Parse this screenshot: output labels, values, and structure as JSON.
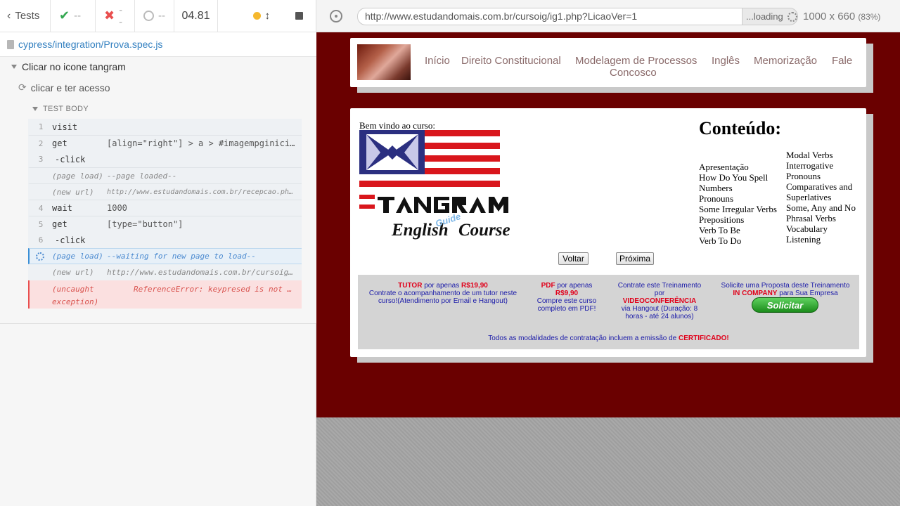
{
  "reporter": {
    "back_label": "Tests",
    "passed": "--",
    "failed": "--",
    "pending": "--",
    "duration": "04.81",
    "spec_path": "cypress/integration/Prova.spec.js",
    "suite_title": "Clicar no icone tangram",
    "test_title": "clicar e ter acesso",
    "body_label": "TEST BODY",
    "commands": [
      {
        "num": "1",
        "name": "visit",
        "msg": ""
      },
      {
        "num": "2",
        "name": "get",
        "msg": "[align=\"right\"] > a > #imagempginicial2"
      },
      {
        "num": "3",
        "name": "-click",
        "msg": ""
      },
      {
        "num": "",
        "name": "(page load)",
        "msg": "--page loaded--"
      },
      {
        "num": "",
        "name": "(new url)",
        "msg": "http://www.estudandomais.com.br/recepcao.php?Di…"
      },
      {
        "num": "4",
        "name": "wait",
        "msg": "1000"
      },
      {
        "num": "5",
        "name": "get",
        "msg": "[type=\"button\"]"
      },
      {
        "num": "6",
        "name": "-click",
        "msg": ""
      },
      {
        "num": "",
        "name": "(page load)",
        "msg": "--waiting for new page to load--"
      },
      {
        "num": "",
        "name": "(new url)",
        "msg": "http://www.estudandomais.com.br/cursoig/…"
      },
      {
        "num": "",
        "name": "(uncaught exception)",
        "msg": "ReferenceError: keypresed is not d…"
      }
    ]
  },
  "browser": {
    "url": "http://www.estudandomais.com.br/cursoig/ig1.php?LicaoVer=1",
    "loading_label": "...loading",
    "viewport": "1000 x 660",
    "scale": "(83%)"
  },
  "site": {
    "menu": [
      "Início",
      "Direito Constitucional",
      "Modelagem de Processos",
      "Inglês",
      "Memorização",
      "Fale",
      "Concosco"
    ],
    "welcome": "Bem vindo ao curso:",
    "logo_text": {
      "tangram": "TANGRAM",
      "english": "English",
      "course": "Course",
      "guide": "Guide"
    },
    "content_title": "Conteúdo:",
    "lessons_col1": [
      "Apresentação",
      "How Do You Spell",
      "Numbers",
      "Pronouns",
      "Some Irregular Verbs",
      "Prepositions",
      "Verb To Be",
      "Verb To Do"
    ],
    "lessons_col2": [
      "Modal Verbs",
      "Interrogative",
      "Pronouns",
      "Comparatives and",
      "Superlatives",
      "Some, Any and No",
      "Phrasal Verbs",
      "Vocabulary",
      "Listening"
    ],
    "btn_back": "Voltar",
    "btn_next": "Próxima",
    "promo": {
      "tutor_red": "TUTOR",
      "tutor_rest": "por apenas",
      "tutor_price": "R$19,90",
      "tutor_desc": "Contrate o acompanhamento de um tutor neste curso!(Atendimento por Email e Hangout)",
      "pdf_red": "PDF",
      "pdf_rest": "por apenas",
      "pdf_price": "R$9,90",
      "pdf_desc": "Compre este curso completo em PDF!",
      "video_pre": "Contrate este Treinamento por",
      "video_red": "VIDEOCONFERÊNCIA",
      "video_desc": "via Hangout (Duração: 8 horas - até 24 alunos)",
      "company_pre": "Solicite uma Proposta deste Treinamento",
      "company_red": "IN COMPANY",
      "company_rest": "para Sua Empresa",
      "solicitar": "Solicitar",
      "cert_pre": "Todos as modalidades de contratação incluem a emissão de",
      "cert_red": "CERTIFICADO!"
    }
  },
  "colors": {
    "aut_background": "#6a0000",
    "passed_green": "#35a852",
    "failed_red": "#e94f4f",
    "pending_blue": "#3a8fd6",
    "spec_link": "#3380c0"
  }
}
